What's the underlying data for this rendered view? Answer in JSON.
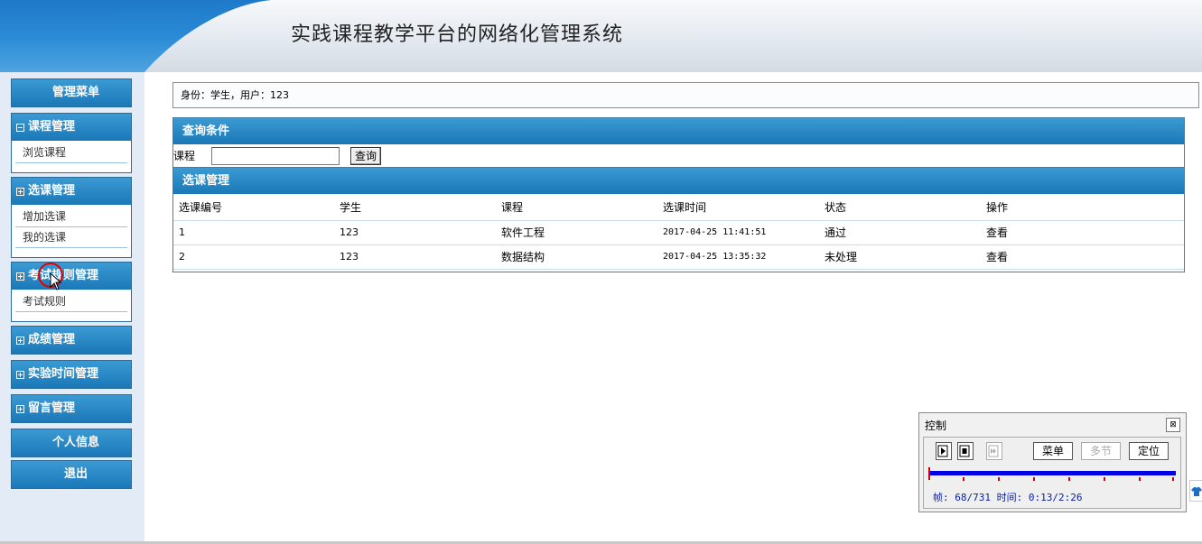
{
  "header": {
    "title": "实践课程教学平台的网络化管理系统"
  },
  "sidebar": {
    "menu_title": "管理菜单",
    "groups": [
      {
        "title": "课程管理",
        "expanded": true,
        "items": [
          "浏览课程"
        ]
      },
      {
        "title": "选课管理",
        "expanded": false,
        "items": [
          "增加选课",
          "我的选课"
        ]
      },
      {
        "title": "考试规则管理",
        "expanded": false,
        "items": [
          "考试规则"
        ]
      },
      {
        "title": "成绩管理",
        "expanded": false,
        "items": []
      },
      {
        "title": "实验时间管理",
        "expanded": false,
        "items": []
      },
      {
        "title": "留言管理",
        "expanded": false,
        "items": []
      }
    ],
    "personal_info": "个人信息",
    "logout": "退出"
  },
  "identity": {
    "text": "身份：学生，用户：123"
  },
  "query": {
    "title": "查询条件",
    "course_label": "课程",
    "course_value": "",
    "query_button": "查询"
  },
  "selection": {
    "title": "选课管理",
    "columns": [
      "选课编号",
      "学生",
      "课程",
      "选课时间",
      "状态",
      "操作"
    ],
    "rows": [
      {
        "id": "1",
        "student": "123",
        "course": "软件工程",
        "time": "2017-04-25 11:41:51",
        "status": "通过",
        "action": "查看"
      },
      {
        "id": "2",
        "student": "123",
        "course": "数据结构",
        "time": "2017-04-25 13:35:32",
        "status": "未处理",
        "action": "查看"
      }
    ]
  },
  "control": {
    "title": "控制",
    "close": "⊠",
    "menu_button": "菜单",
    "multi_button": "多节",
    "locate_button": "定位",
    "status": "帧: 68/731 时间: 0:13/2:26",
    "progress": 0.093
  },
  "colors": {
    "accent": "#1a78b8",
    "timeline": "#0000e6",
    "marker": "#d40000"
  }
}
